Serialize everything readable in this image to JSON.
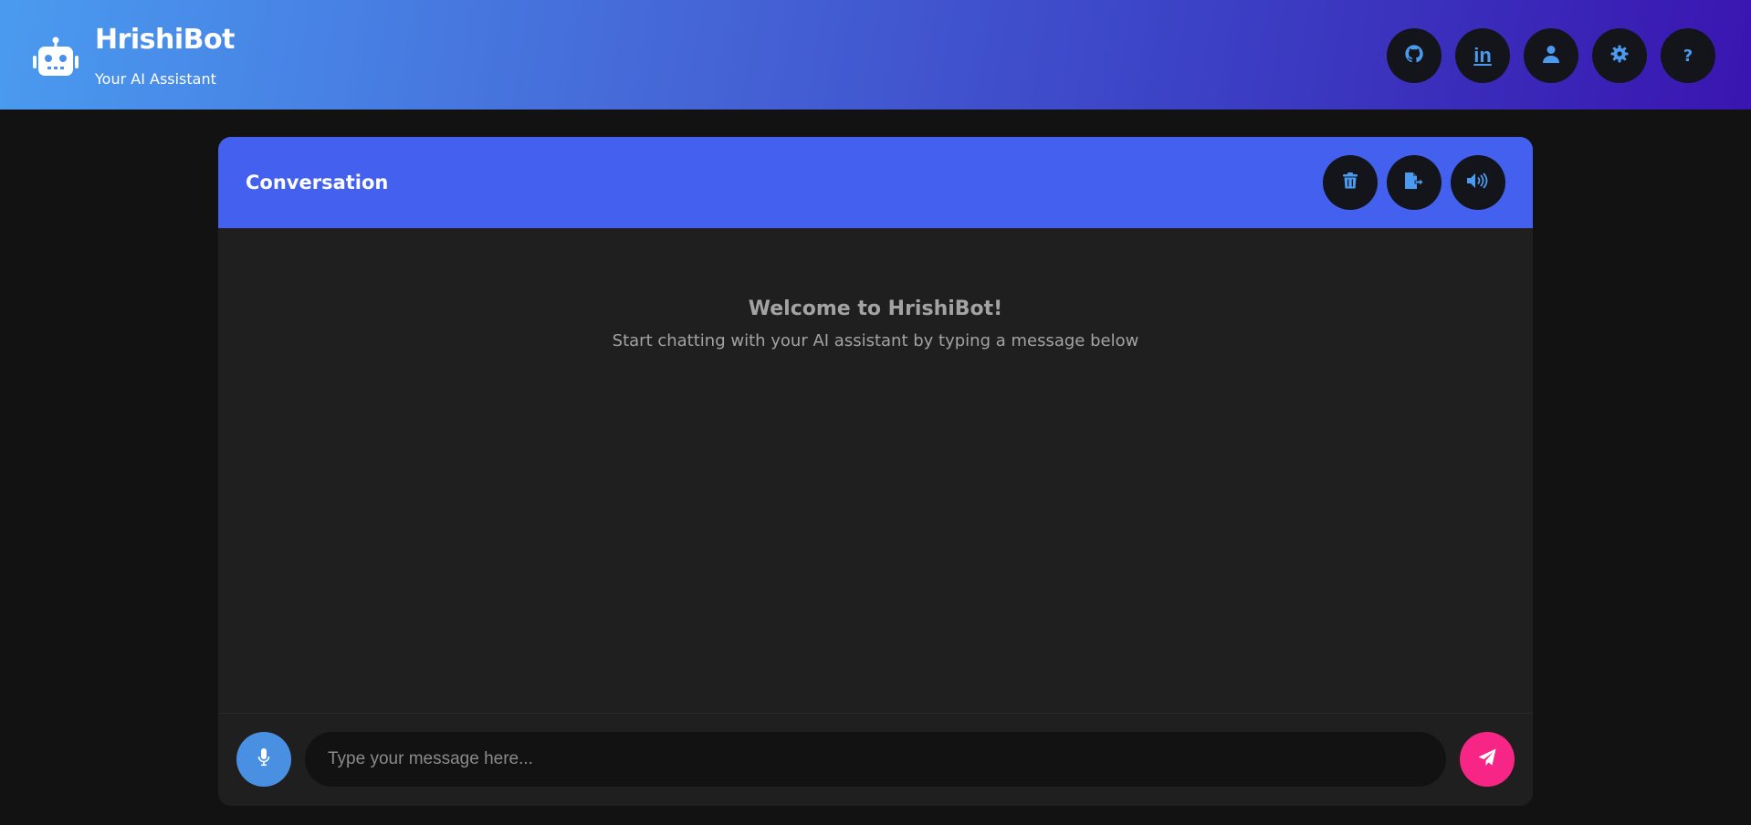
{
  "header": {
    "title": "HrishiBot",
    "subtitle": "Your AI Assistant",
    "logo_icon": "robot-icon",
    "nav_buttons": [
      {
        "icon": "github-icon"
      },
      {
        "icon": "linkedin-icon",
        "text": "in"
      },
      {
        "icon": "user-icon"
      },
      {
        "icon": "gear-icon"
      },
      {
        "icon": "help-icon",
        "text": "?"
      }
    ]
  },
  "conversation": {
    "title": "Conversation",
    "actions": [
      {
        "icon": "trash-icon"
      },
      {
        "icon": "export-file-icon"
      },
      {
        "icon": "speaker-icon"
      }
    ],
    "welcome_title": "Welcome to HrishiBot!",
    "welcome_text": "Start chatting with your AI assistant by typing a message below"
  },
  "input": {
    "placeholder": "Type your message here...",
    "mic_icon": "microphone-icon",
    "send_icon": "send-icon"
  },
  "colors": {
    "accent": "#4361ee",
    "icon_blue": "#4a9bf0",
    "mic": "#4a90e2",
    "send": "#f72585",
    "background": "#121212",
    "panel": "#1f1f1f"
  }
}
